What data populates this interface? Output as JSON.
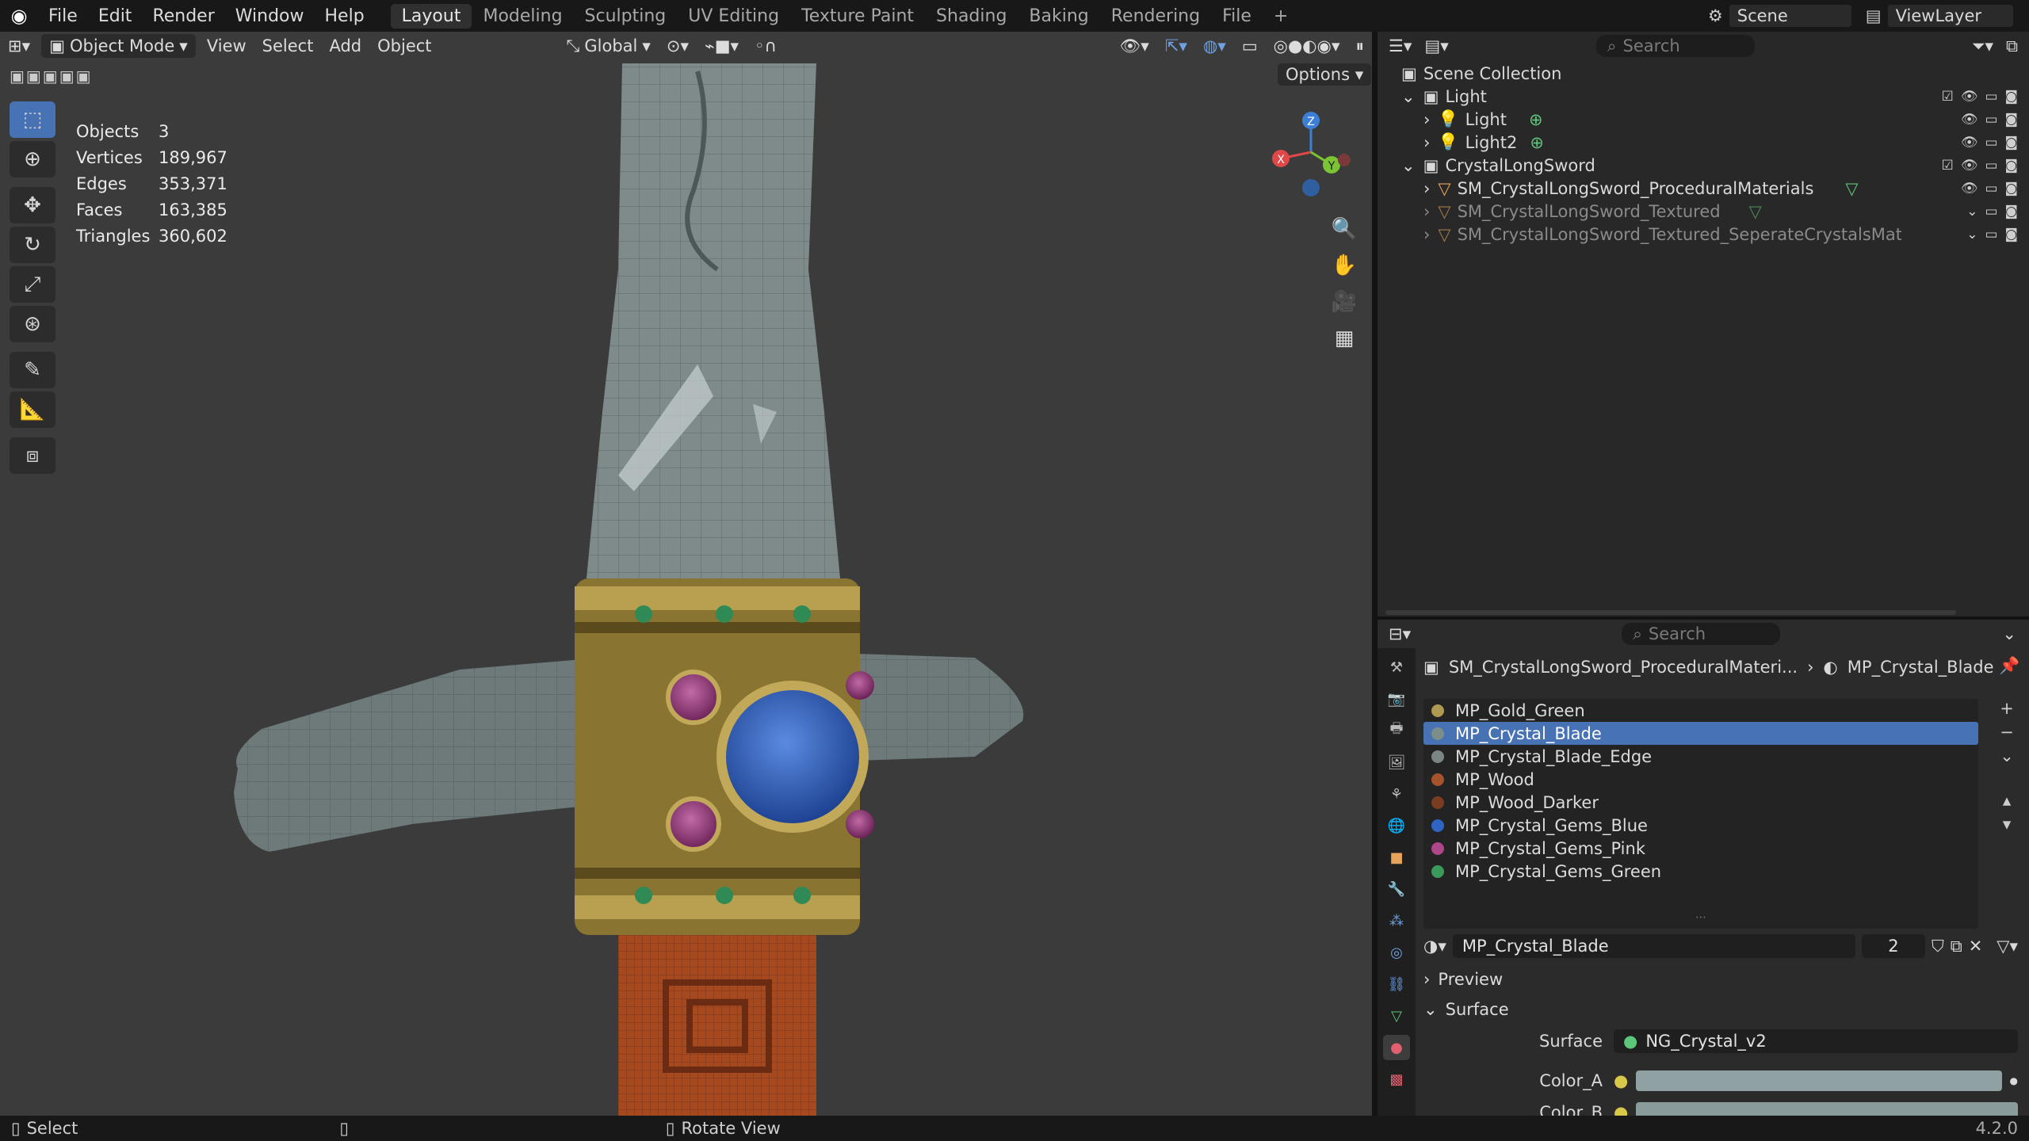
{
  "topbar": {
    "menus": [
      "File",
      "Edit",
      "Render",
      "Window",
      "Help"
    ],
    "workspaces": [
      "Layout",
      "Modeling",
      "Sculpting",
      "UV Editing",
      "Texture Paint",
      "Shading",
      "Baking",
      "Rendering",
      "File"
    ],
    "active_workspace": "Layout",
    "scene": "Scene",
    "view_layer": "ViewLayer"
  },
  "viewport": {
    "mode": "Object Mode",
    "menus": [
      "View",
      "Select",
      "Add",
      "Object"
    ],
    "orientation": "Global",
    "options_label": "Options",
    "stats": [
      {
        "label": "Objects",
        "value": "3"
      },
      {
        "label": "Vertices",
        "value": "189,967"
      },
      {
        "label": "Edges",
        "value": "353,371"
      },
      {
        "label": "Faces",
        "value": "163,385"
      },
      {
        "label": "Triangles",
        "value": "360,602"
      }
    ],
    "gizmo_axes": {
      "x": "X",
      "y": "Y",
      "z": "Z"
    }
  },
  "outliner": {
    "search_placeholder": "Search",
    "root": "Scene Collection",
    "rows": [
      {
        "label": "Light",
        "type": "collection",
        "indent": 0
      },
      {
        "label": "Light",
        "type": "light",
        "indent": 1
      },
      {
        "label": "Light2",
        "type": "light",
        "indent": 1
      },
      {
        "label": "CrystalLongSword",
        "type": "collection",
        "indent": 0
      },
      {
        "label": "SM_CrystalLongSword_ProceduralMaterials",
        "type": "mesh",
        "indent": 1
      },
      {
        "label": "SM_CrystalLongSword_Textured",
        "type": "mesh-hidden",
        "indent": 1
      },
      {
        "label": "SM_CrystalLongSword_Textured_SeperateCrystalsMaterials",
        "type": "mesh-hidden",
        "indent": 1
      }
    ]
  },
  "properties": {
    "search_placeholder": "Search",
    "breadcrumb_object": "SM_CrystalLongSword_ProceduralMateri...",
    "breadcrumb_material": "MP_Crystal_Blade",
    "materials": [
      {
        "name": "MP_Gold_Green",
        "color": "#b09a52"
      },
      {
        "name": "MP_Crystal_Blade",
        "color": "#7d8d8a"
      },
      {
        "name": "MP_Crystal_Blade_Edge",
        "color": "#7a8584"
      },
      {
        "name": "MP_Wood",
        "color": "#a4532a"
      },
      {
        "name": "MP_Wood_Darker",
        "color": "#7a3d22"
      },
      {
        "name": "MP_Crystal_Gems_Blue",
        "color": "#2f63c4"
      },
      {
        "name": "MP_Crystal_Gems_Pink",
        "color": "#b0468a"
      },
      {
        "name": "MP_Crystal_Gems_Green",
        "color": "#3a9a5a"
      }
    ],
    "selected_material": "MP_Crystal_Blade",
    "users": "2",
    "preview_label": "Preview",
    "surface_section": "Surface",
    "surface_label": "Surface",
    "surface_value": "NG_Crystal_v2",
    "color_a_label": "Color_A",
    "color_b_label": "Color_B"
  },
  "statusbar": {
    "left": "Select",
    "middle": "Rotate View",
    "version": "4.2.0"
  },
  "colors": {
    "accent": "#4772b3",
    "bg": "#3b3b3b"
  }
}
